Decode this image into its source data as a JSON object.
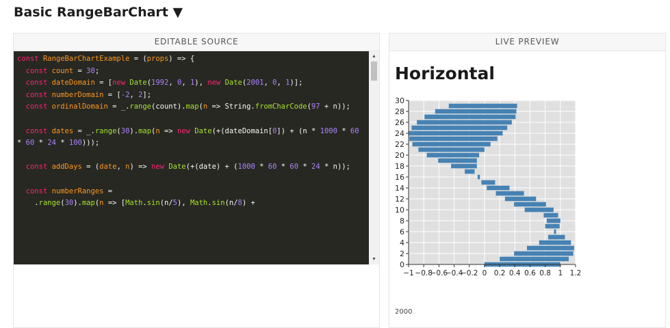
{
  "page": {
    "title": "Basic RangeBarChart",
    "title_toggle_glyph": "▼"
  },
  "editor_panel": {
    "header": "EDITABLE SOURCE",
    "code_lines": [
      [
        [
          "const ",
          "kw"
        ],
        [
          "RangeBarChartExample",
          "vr"
        ],
        [
          " = ("
        ],
        [
          "props",
          "vr"
        ],
        [
          ") => {"
        ]
      ],
      [
        [
          "  "
        ],
        [
          "const ",
          "kw"
        ],
        [
          "count",
          "vr"
        ],
        [
          " = "
        ],
        [
          "30",
          "nm"
        ],
        [
          ";"
        ]
      ],
      [
        [
          "  "
        ],
        [
          "const ",
          "kw"
        ],
        [
          "dateDomain",
          "vr"
        ],
        [
          " = ["
        ],
        [
          "new ",
          "kw"
        ],
        [
          "Date",
          "fn"
        ],
        [
          "("
        ],
        [
          "1992",
          "nm"
        ],
        [
          ", "
        ],
        [
          "0",
          "nm"
        ],
        [
          ", "
        ],
        [
          "1",
          "nm"
        ],
        [
          "), "
        ],
        [
          "new ",
          "kw"
        ],
        [
          "Date",
          "fn"
        ],
        [
          "("
        ],
        [
          "2001",
          "nm"
        ],
        [
          ", "
        ],
        [
          "0",
          "nm"
        ],
        [
          ", "
        ],
        [
          "1",
          "nm"
        ],
        [
          ")];"
        ]
      ],
      [
        [
          "  "
        ],
        [
          "const ",
          "kw"
        ],
        [
          "numberDomain",
          "vr"
        ],
        [
          " = ["
        ],
        [
          "-2",
          "nm"
        ],
        [
          ", "
        ],
        [
          "2",
          "nm"
        ],
        [
          "];"
        ]
      ],
      [
        [
          "  "
        ],
        [
          "const ",
          "kw"
        ],
        [
          "ordinalDomain",
          "vr"
        ],
        [
          " = _."
        ],
        [
          "range",
          "fn"
        ],
        [
          "(count)."
        ],
        [
          "map",
          "fn"
        ],
        [
          "("
        ],
        [
          "n",
          "vr"
        ],
        [
          " => String."
        ],
        [
          "fromCharCode",
          "fn"
        ],
        [
          "("
        ],
        [
          "97",
          "nm"
        ],
        [
          " + n));"
        ]
      ],
      [
        [
          ""
        ]
      ],
      [
        [
          "  "
        ],
        [
          "const ",
          "kw"
        ],
        [
          "dates",
          "vr"
        ],
        [
          " = _."
        ],
        [
          "range",
          "fn"
        ],
        [
          "("
        ],
        [
          "30",
          "nm"
        ],
        [
          ")."
        ],
        [
          "map",
          "fn"
        ],
        [
          "("
        ],
        [
          "n",
          "vr"
        ],
        [
          " => "
        ],
        [
          "new ",
          "kw"
        ],
        [
          "Date",
          "fn"
        ],
        [
          "(+(dateDomain["
        ],
        [
          "0",
          "nm"
        ],
        [
          "]) + (n * "
        ],
        [
          "1000",
          "nm"
        ],
        [
          " * "
        ],
        [
          "60",
          "nm"
        ],
        [
          " * "
        ],
        [
          "60",
          "nm"
        ],
        [
          " * "
        ],
        [
          "24",
          "nm"
        ],
        [
          " * "
        ],
        [
          "100",
          "nm"
        ],
        [
          ")));"
        ]
      ],
      [
        [
          ""
        ]
      ],
      [
        [
          "  "
        ],
        [
          "const ",
          "kw"
        ],
        [
          "addDays",
          "vr"
        ],
        [
          " = ("
        ],
        [
          "date",
          "vr"
        ],
        [
          ", "
        ],
        [
          "n",
          "vr"
        ],
        [
          ") => "
        ],
        [
          "new ",
          "kw"
        ],
        [
          "Date",
          "fn"
        ],
        [
          "(+(date) + ("
        ],
        [
          "1000",
          "nm"
        ],
        [
          " * "
        ],
        [
          "60",
          "nm"
        ],
        [
          " * "
        ],
        [
          "60",
          "nm"
        ],
        [
          " * "
        ],
        [
          "24",
          "nm"
        ],
        [
          " * n));"
        ]
      ],
      [
        [
          ""
        ]
      ],
      [
        [
          "  "
        ],
        [
          "const ",
          "kw"
        ],
        [
          "numberRanges",
          "vr"
        ],
        [
          " ="
        ]
      ],
      [
        [
          "    ."
        ],
        [
          "range",
          "fn"
        ],
        [
          "("
        ],
        [
          "30",
          "nm"
        ],
        [
          ")."
        ],
        [
          "map",
          "fn"
        ],
        [
          "("
        ],
        [
          "n",
          "vr"
        ],
        [
          " => ["
        ],
        [
          "Math",
          "fn"
        ],
        [
          "."
        ],
        [
          "sin",
          "fn"
        ],
        [
          "(n/"
        ],
        [
          "5",
          "nm"
        ],
        [
          "), "
        ],
        [
          "Math",
          "fn"
        ],
        [
          "."
        ],
        [
          "sin",
          "fn"
        ],
        [
          "(n/"
        ],
        [
          "8",
          "nm"
        ],
        [
          ") +"
        ]
      ]
    ]
  },
  "preview_panel": {
    "header": "LIVE PREVIEW",
    "chart_heading": "Horizontal",
    "cut_off_text": "2000"
  },
  "chart_data": {
    "type": "bar",
    "orientation": "horizontal",
    "subtype": "range",
    "title": "Horizontal",
    "xlim": [
      -1,
      1.2
    ],
    "ylim": [
      0,
      30
    ],
    "x_ticks": [
      -1,
      -0.8,
      -0.6,
      -0.4,
      -0.2,
      0,
      0.2,
      0.4,
      0.6,
      0.8,
      1,
      1.2
    ],
    "x_tick_labels": [
      "−1",
      "−0.8",
      "−0.6",
      "−0.4",
      "−0.2",
      "0",
      "0.2",
      "0.4",
      "0.6",
      "0.8",
      "1",
      "1.2"
    ],
    "y_ticks": [
      0,
      2,
      4,
      6,
      8,
      10,
      12,
      14,
      16,
      18,
      20,
      22,
      24,
      26,
      28,
      30
    ],
    "grid": true,
    "bar_color": "#4682b4",
    "plot_background": "#e0e0e0",
    "ranges": [
      {
        "y": 0,
        "start": 0.0,
        "end": 1.0
      },
      {
        "y": 1,
        "start": 0.2,
        "end": 1.11
      },
      {
        "y": 2,
        "start": 0.39,
        "end": 1.17
      },
      {
        "y": 3,
        "start": 0.56,
        "end": 1.18
      },
      {
        "y": 4,
        "start": 0.72,
        "end": 1.14
      },
      {
        "y": 5,
        "start": 0.84,
        "end": 1.06
      },
      {
        "y": 6,
        "start": 0.93,
        "end": 0.93
      },
      {
        "y": 7,
        "start": 0.99,
        "end": 0.8
      },
      {
        "y": 8,
        "start": 1.0,
        "end": 0.82
      },
      {
        "y": 9,
        "start": 0.97,
        "end": 0.78
      },
      {
        "y": 10,
        "start": 0.91,
        "end": 0.53
      },
      {
        "y": 11,
        "start": 0.81,
        "end": 0.39
      },
      {
        "y": 12,
        "start": 0.68,
        "end": 0.27
      },
      {
        "y": 13,
        "start": 0.52,
        "end": 0.15
      },
      {
        "y": 14,
        "start": 0.33,
        "end": 0.03
      },
      {
        "y": 15,
        "start": 0.14,
        "end": -0.04
      },
      {
        "y": 16,
        "start": -0.06,
        "end": -0.09
      },
      {
        "y": 17,
        "start": -0.26,
        "end": -0.13
      },
      {
        "y": 18,
        "start": -0.44,
        "end": -0.1
      },
      {
        "y": 19,
        "start": -0.61,
        "end": -0.1
      },
      {
        "y": 20,
        "start": -0.76,
        "end": -0.07
      },
      {
        "y": 21,
        "start": -0.87,
        "end": 0.0
      },
      {
        "y": 22,
        "start": -0.95,
        "end": 0.08
      },
      {
        "y": 23,
        "start": -0.99,
        "end": 0.17
      },
      {
        "y": 24,
        "start": -1.0,
        "end": 0.24
      },
      {
        "y": 25,
        "start": -0.96,
        "end": 0.3
      },
      {
        "y": 26,
        "start": -0.89,
        "end": 0.36
      },
      {
        "y": 27,
        "start": -0.79,
        "end": 0.41
      },
      {
        "y": 28,
        "start": -0.65,
        "end": 0.42
      },
      {
        "y": 29,
        "start": -0.47,
        "end": 0.43
      }
    ]
  }
}
